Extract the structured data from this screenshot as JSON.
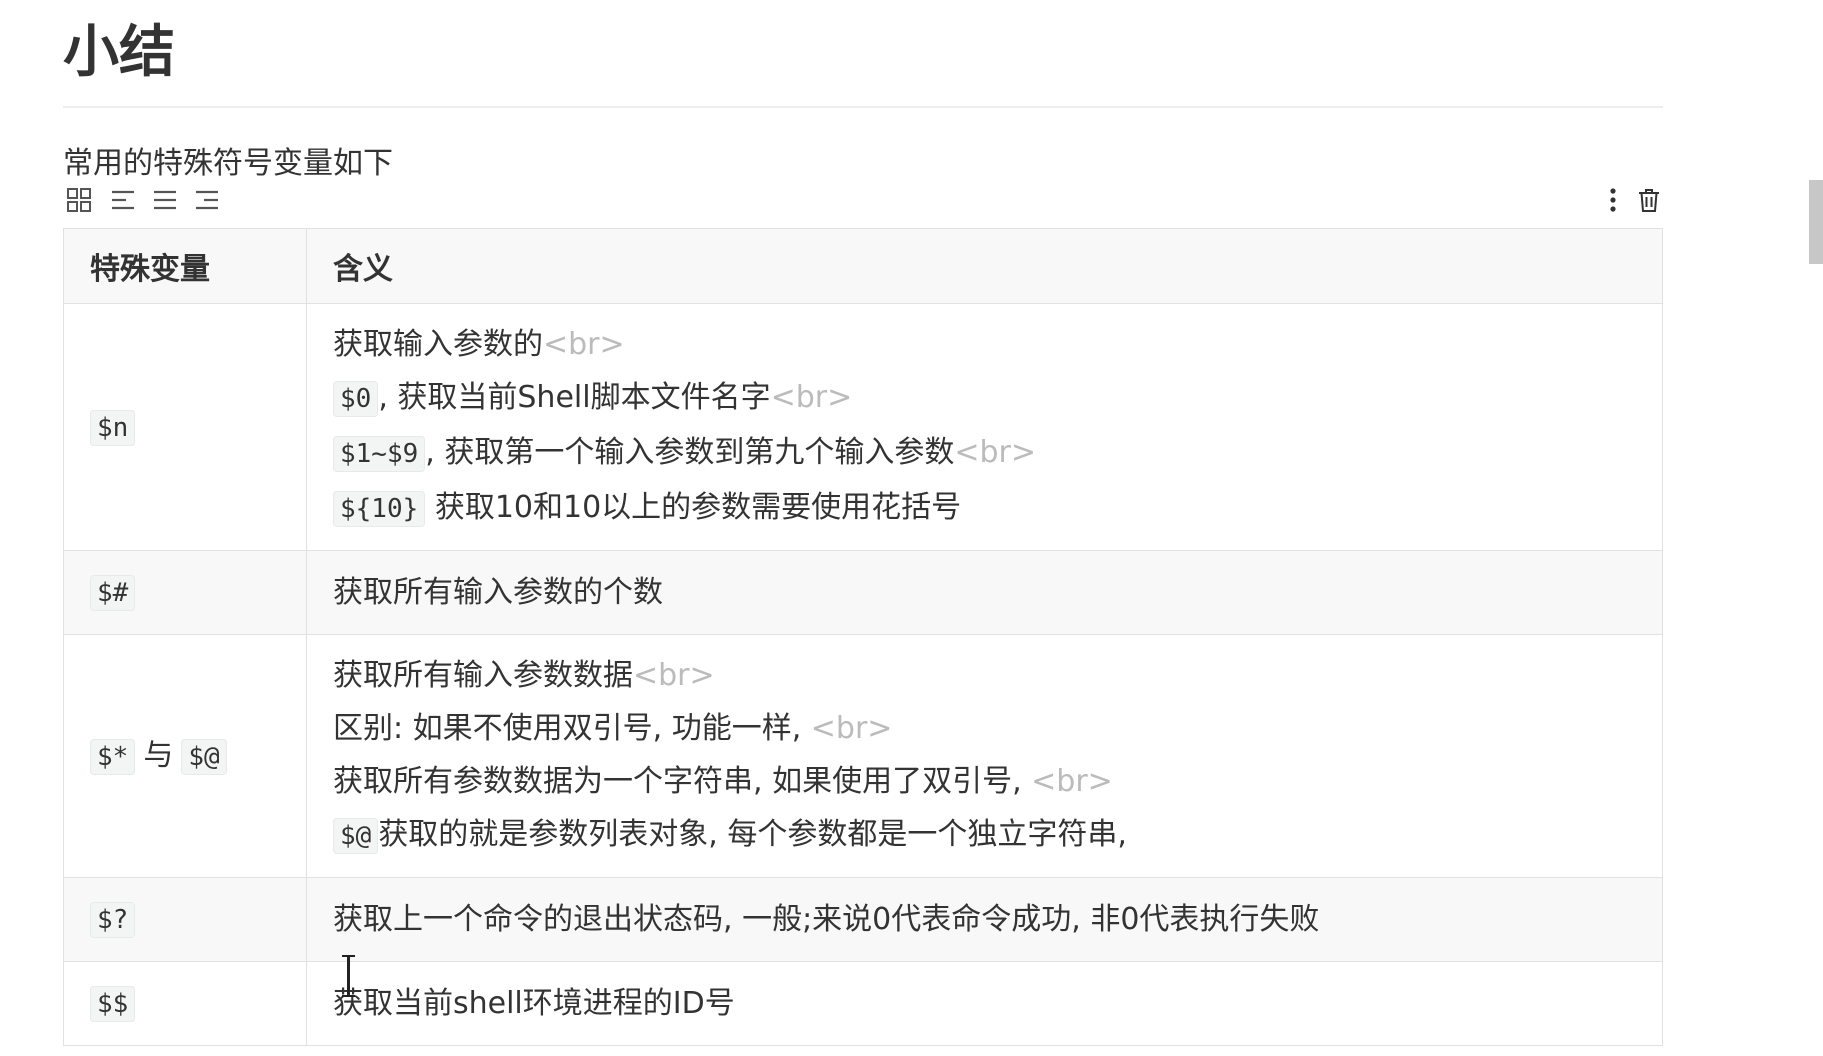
{
  "heading": "小结",
  "intro": "常用的特殊符号变量如下",
  "toolbar": {
    "left_icons": [
      "grid-icon",
      "align-left-icon",
      "align-center-icon",
      "align-right-icon"
    ],
    "right_icons": [
      "more-vertical-icon",
      "trash-icon"
    ]
  },
  "table": {
    "headers": [
      "特殊变量",
      "含义"
    ],
    "rows": [
      {
        "var": "$n",
        "lines": [
          {
            "code": "",
            "text": "获取输入参数的",
            "br": "<br>"
          },
          {
            "code": "$0",
            "text": ", 获取当前Shell脚本文件名字",
            "br": "<br>"
          },
          {
            "code": "$1~$9",
            "text": ", 获取第一个输入参数到第九个输入参数",
            "br": "<br>"
          },
          {
            "code": "${10}",
            "text": " 获取10和10以上的参数需要使用花括号",
            "br": ""
          }
        ]
      },
      {
        "var": "$#",
        "lines": [
          {
            "code": "",
            "text": "获取所有输入参数的个数",
            "br": ""
          }
        ]
      },
      {
        "var": "$*",
        "var_joiner": "与",
        "var2": "$@",
        "lines": [
          {
            "code": "",
            "text": "获取所有输入参数数据",
            "br": "<br>"
          },
          {
            "code": "",
            "text": "区别: 如果不使用双引号, 功能一样, ",
            "br": "<br>"
          },
          {
            "code": "",
            "text": "获取所有参数数据为一个字符串, 如果使用了双引号, ",
            "br": "<br>"
          },
          {
            "code": "$@",
            "text": "获取的就是参数列表对象, 每个参数都是一个独立字符串,",
            "br": ""
          }
        ]
      },
      {
        "var": "$?",
        "lines": [
          {
            "code": "",
            "text": "获取上一个命令的退出状态码, 一般;来说0代表命令成功, 非0代表执行失败",
            "br": ""
          }
        ]
      },
      {
        "var": "$$",
        "lines": [
          {
            "code": "",
            "text": "获取当前shell环境进程的ID号",
            "br": ""
          }
        ]
      }
    ]
  }
}
